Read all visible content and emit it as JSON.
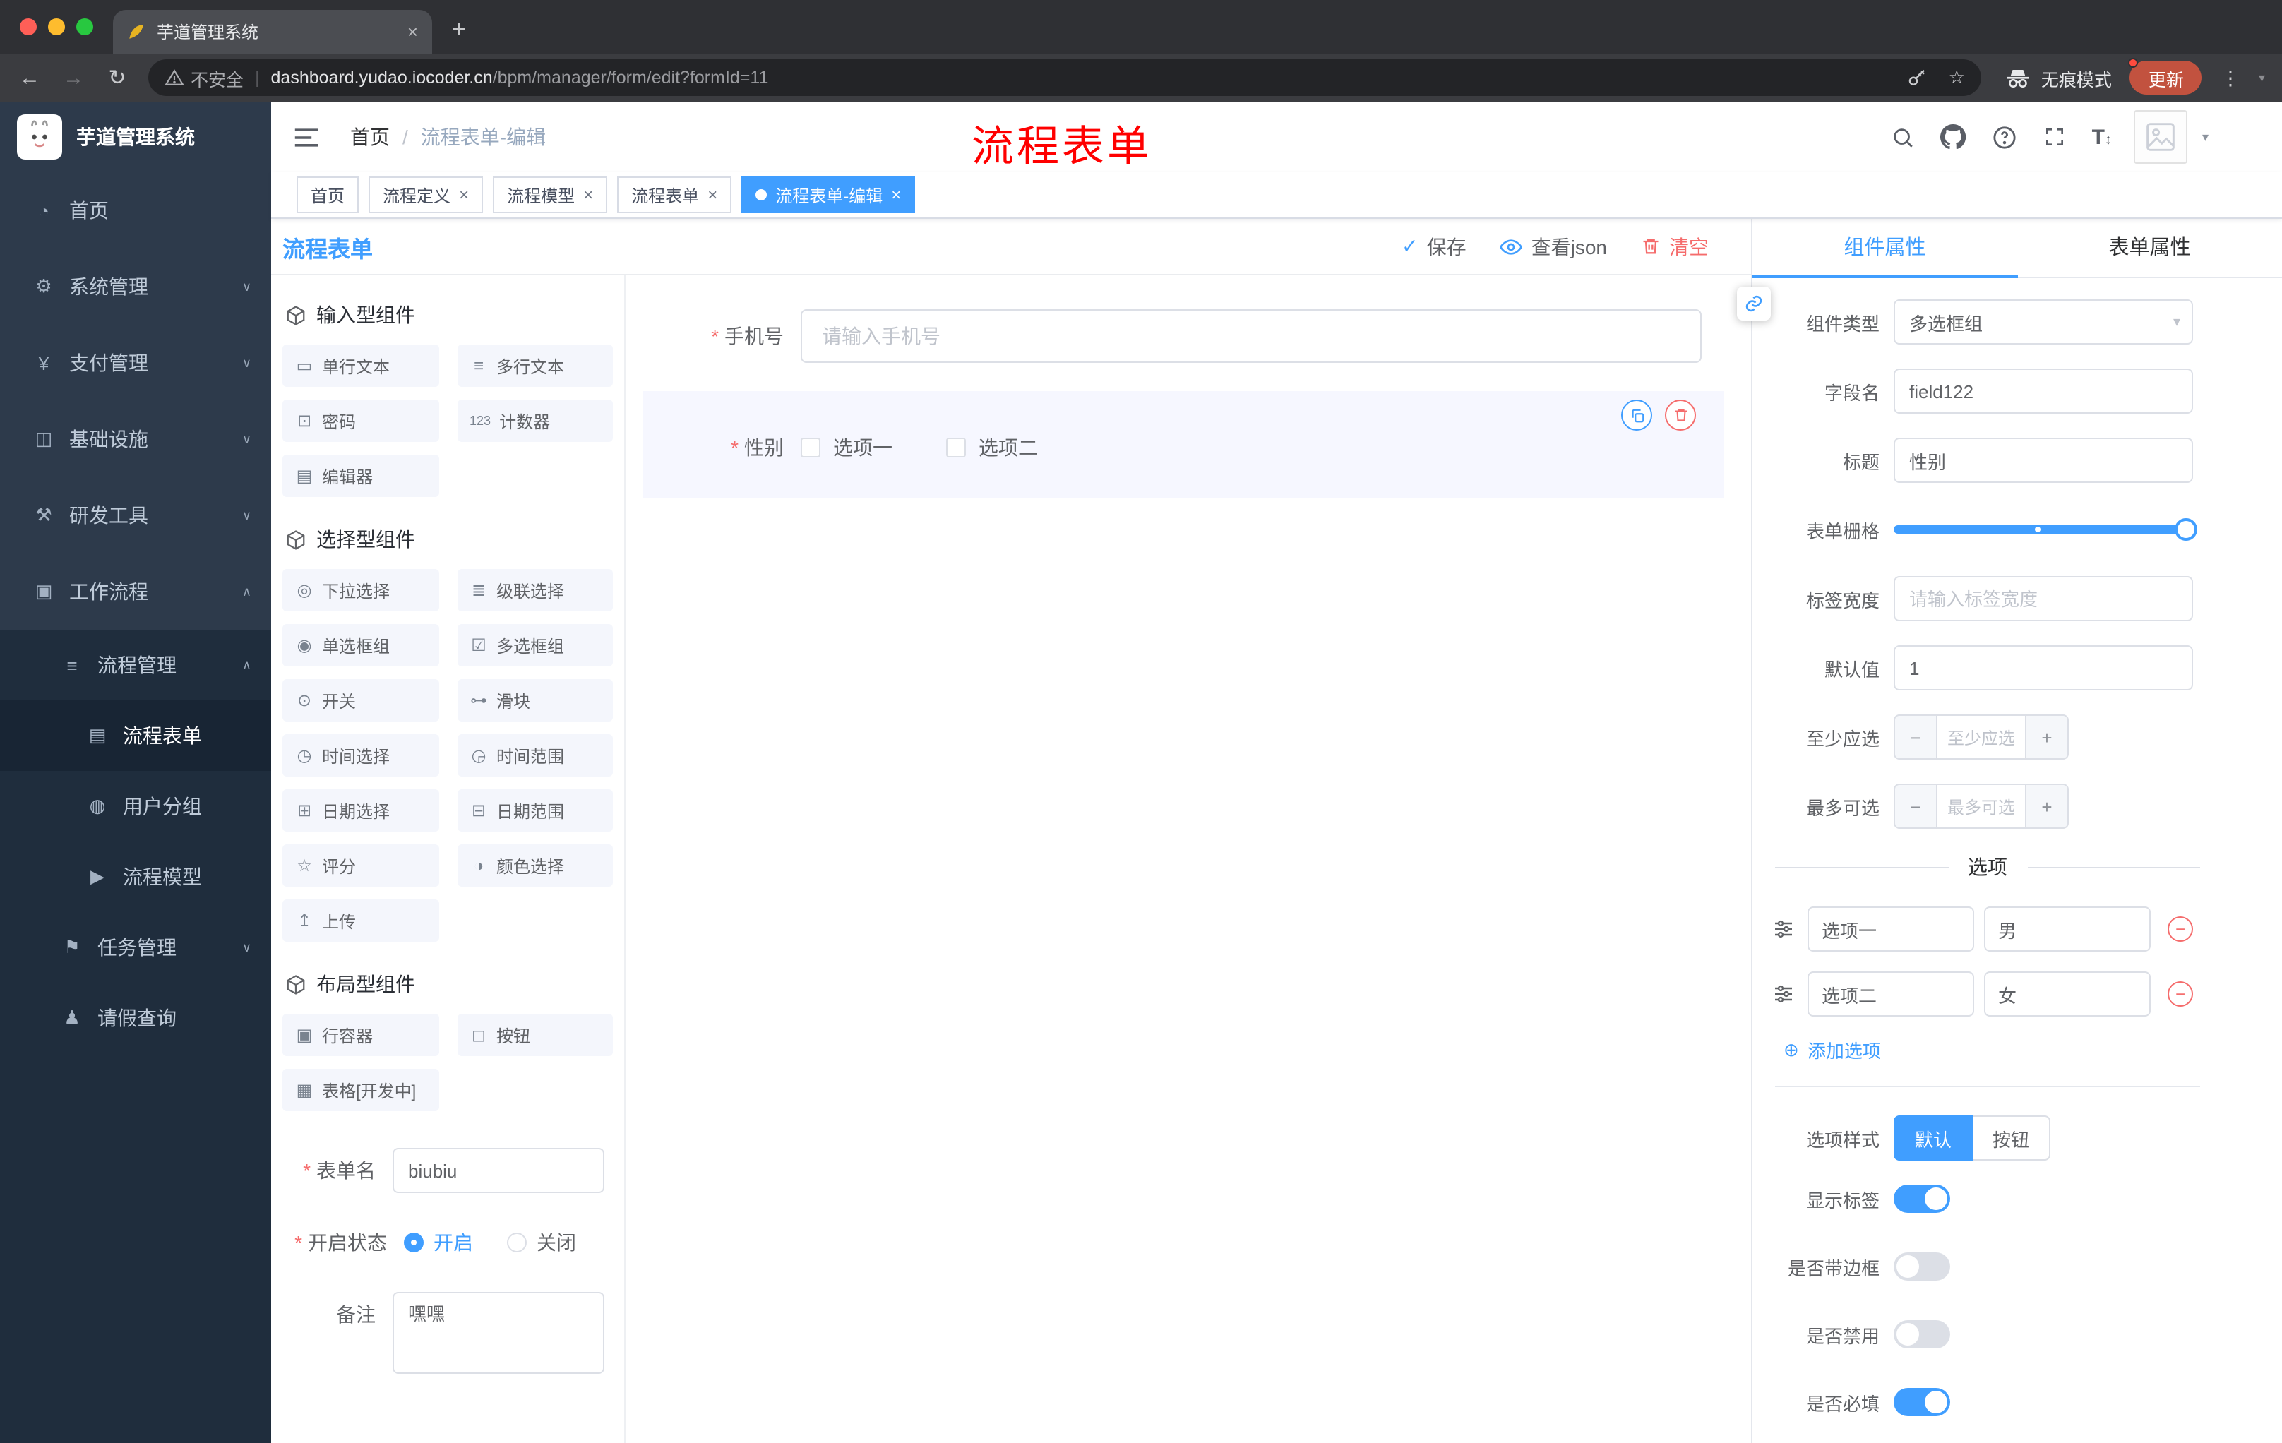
{
  "colors": {
    "accent": "#409eff",
    "danger": "#f56c6c",
    "annotation": "#ff0000",
    "traffic": [
      "#ff5f57",
      "#febc2e",
      "#28c840"
    ]
  },
  "icons": {
    "close": "×",
    "new_tab": "+",
    "back": "←",
    "forward": "→",
    "reload": "↻",
    "star": "☆",
    "dots": "⋮",
    "caret_down": "▾",
    "check": "✓",
    "minus": "−",
    "plus": "+",
    "add": "⊕",
    "font_size": "T",
    "updown": "↕",
    "select_caret": "▾"
  },
  "browser": {
    "tab_title": "芋道管理系统",
    "security_label": "不安全",
    "url_host": "dashboard.yudao.iocoder.cn",
    "url_path": "/bpm/manager/form/edit?formId=11",
    "incognito_label": "无痕模式",
    "update_label": "更新"
  },
  "sidebar": {
    "logo_title": "芋道管理系统",
    "menu": [
      {
        "label": "首页",
        "glyph": "◔",
        "chevron": ""
      },
      {
        "label": "系统管理",
        "glyph": "⚙",
        "chevron": "∨"
      },
      {
        "label": "支付管理",
        "glyph": "¥",
        "chevron": "∨"
      },
      {
        "label": "基础设施",
        "glyph": "◫",
        "chevron": "∨"
      },
      {
        "label": "研发工具",
        "glyph": "⚒",
        "chevron": "∨"
      },
      {
        "label": "工作流程",
        "glyph": "▣",
        "chevron": "∧"
      }
    ],
    "submenu": [
      {
        "label": "流程管理",
        "glyph": "≡",
        "chevron": "∧"
      },
      {
        "label": "流程表单",
        "glyph": "▤",
        "chevron": ""
      },
      {
        "label": "用户分组",
        "glyph": "◍",
        "chevron": ""
      },
      {
        "label": "流程模型",
        "glyph": "▶",
        "chevron": ""
      },
      {
        "label": "任务管理",
        "glyph": "⚑",
        "chevron": "∨"
      },
      {
        "label": "请假查询",
        "glyph": "♟",
        "chevron": ""
      }
    ]
  },
  "header": {
    "breadcrumb_home": "首页",
    "breadcrumb_sep": "/",
    "breadcrumb_current": "流程表单-编辑",
    "annotation": "流程表单"
  },
  "tags": [
    {
      "label": "首页"
    },
    {
      "label": "流程定义"
    },
    {
      "label": "流程模型"
    },
    {
      "label": "流程表单"
    },
    {
      "label": "流程表单-编辑"
    }
  ],
  "designer": {
    "panel_title": "流程表单",
    "toolbar": {
      "save": "保存",
      "view_json": "查看json",
      "clear": "清空"
    },
    "groups": [
      {
        "title": "输入型组件",
        "items": [
          {
            "label": "单行文本",
            "glyph": "▭"
          },
          {
            "label": "多行文本",
            "glyph": "≡"
          },
          {
            "label": "密码",
            "glyph": "⊡"
          },
          {
            "label": "计数器",
            "glyph": "123"
          },
          {
            "label": "编辑器",
            "glyph": "▤"
          }
        ]
      },
      {
        "title": "选择型组件",
        "items": [
          {
            "label": "下拉选择",
            "glyph": "◎"
          },
          {
            "label": "级联选择",
            "glyph": "≣"
          },
          {
            "label": "单选框组",
            "glyph": "◉"
          },
          {
            "label": "多选框组",
            "glyph": "☑"
          },
          {
            "label": "开关",
            "glyph": "⊙"
          },
          {
            "label": "滑块",
            "glyph": "⊶"
          },
          {
            "label": "时间选择",
            "glyph": "◷"
          },
          {
            "label": "时间范围",
            "glyph": "◶"
          },
          {
            "label": "日期选择",
            "glyph": "⊞"
          },
          {
            "label": "日期范围",
            "glyph": "⊟"
          },
          {
            "label": "评分",
            "glyph": "☆"
          },
          {
            "label": "颜色选择",
            "glyph": "◑"
          },
          {
            "label": "上传",
            "glyph": "↥"
          }
        ]
      },
      {
        "title": "布局型组件",
        "items": [
          {
            "label": "行容器",
            "glyph": "▣"
          },
          {
            "label": "按钮",
            "glyph": "◻"
          },
          {
            "label": "表格[开发中]",
            "glyph": "▦"
          }
        ]
      }
    ],
    "meta": {
      "name_label": "表单名",
      "name_value": "biubiu",
      "status_label": "开启状态",
      "status_on": "开启",
      "status_off": "关闭",
      "remark_label": "备注",
      "remark_value": "嘿嘿"
    },
    "canvas": {
      "phone_label": "手机号",
      "phone_placeholder": "请输入手机号",
      "gender_label": "性别",
      "gender_opt1": "选项一",
      "gender_opt2": "选项二"
    }
  },
  "props": {
    "tab_component": "组件属性",
    "tab_form": "表单属性",
    "rows": {
      "type_label": "组件类型",
      "type_value": "多选框组",
      "field_label": "字段名",
      "field_value": "field122",
      "title_label": "标题",
      "title_value": "性别",
      "grid_label": "表单栅格",
      "width_label": "标签宽度",
      "width_placeholder": "请输入标签宽度",
      "default_label": "默认值",
      "default_value": "1",
      "min_label": "至少应选",
      "min_placeholder": "至少应选",
      "max_label": "最多可选",
      "max_placeholder": "最多可选"
    },
    "options_title": "选项",
    "options": [
      {
        "label": "选项一",
        "value": "男"
      },
      {
        "label": "选项二",
        "value": "女"
      }
    ],
    "add_option": "添加选项",
    "style_label": "选项样式",
    "style_default": "默认",
    "style_button": "按钮",
    "show_label": "显示标签",
    "border_label": "是否带边框",
    "disabled_label": "是否禁用",
    "required_label": "是否必填"
  }
}
